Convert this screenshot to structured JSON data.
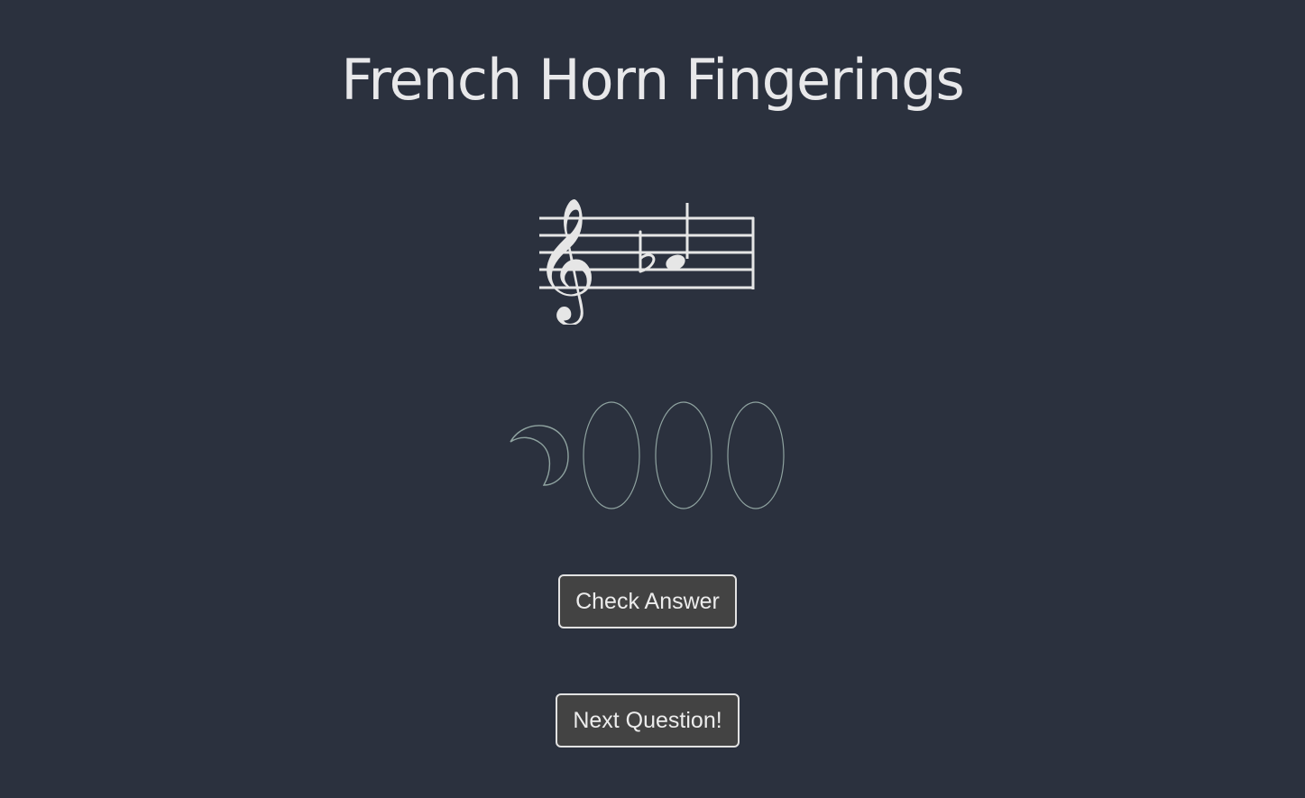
{
  "page": {
    "title": "French Horn Fingerings"
  },
  "note": {
    "clef": "treble",
    "accidental": "flat",
    "duration": "quarter"
  },
  "valves": {
    "items": [
      {
        "name": "thumb-valve",
        "shape": "crescent",
        "pressed": false
      },
      {
        "name": "valve-1",
        "shape": "oval",
        "pressed": false
      },
      {
        "name": "valve-2",
        "shape": "oval",
        "pressed": false
      },
      {
        "name": "valve-3",
        "shape": "oval",
        "pressed": false
      }
    ]
  },
  "buttons": {
    "check_label": "Check Answer",
    "next_label": "Next Question!"
  },
  "colors": {
    "background": "#2b313e",
    "foreground": "#e6e6e6",
    "valve_outline": "#8fa3a0",
    "button_bg": "#434343",
    "button_border": "#e2e2e2"
  }
}
